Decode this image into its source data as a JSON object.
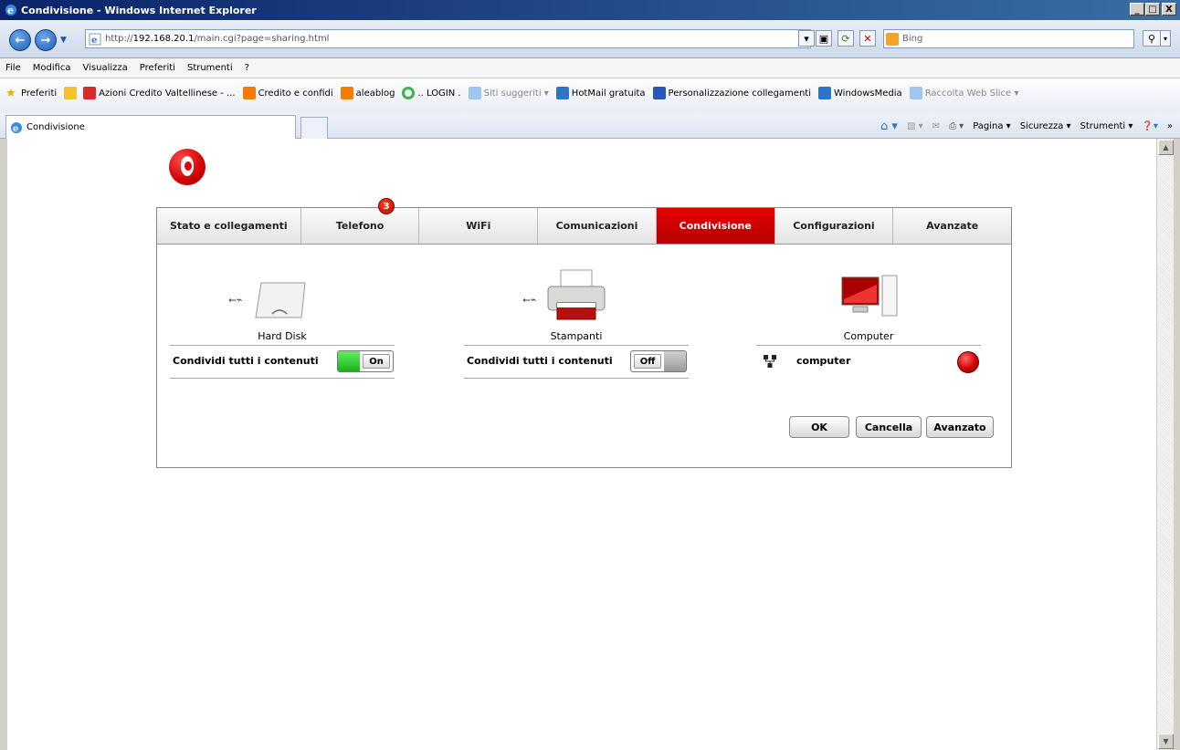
{
  "window": {
    "title": "Condivisione - Windows Internet Explorer",
    "controls": [
      "_",
      "□",
      "X"
    ]
  },
  "address": {
    "url_prefix": "http://",
    "url_host": "192.168.20.1",
    "url_path": "/main.cgi?page=sharing.html",
    "search_placeholder": "Bing"
  },
  "menu": [
    "File",
    "Modifica",
    "Visualizza",
    "Preferiti",
    "Strumenti",
    "?"
  ],
  "favorites": {
    "label": "Preferiti",
    "items": [
      {
        "label": "Azioni Credito Valtellinese - ...",
        "color": "#d82c2c",
        "dim": false
      },
      {
        "label": "Credito e confidi",
        "color": "#f57c00",
        "dim": false
      },
      {
        "label": "aleablog",
        "color": "#f57c00",
        "dim": false
      },
      {
        "label": ".. LOGIN .",
        "color": "#3bb54a",
        "dim": false
      },
      {
        "label": "Siti suggeriti ▾",
        "color": "#2c76c9",
        "dim": true
      },
      {
        "label": "HotMail gratuita",
        "color": "#2c76c9",
        "dim": false
      },
      {
        "label": "Personalizzazione collegamenti",
        "color": "#2a57b8",
        "dim": false
      },
      {
        "label": "WindowsMedia",
        "color": "#2c76c9",
        "dim": false
      },
      {
        "label": "Raccolta Web Slice ▾",
        "color": "#2c76c9",
        "dim": true
      }
    ]
  },
  "tabbar": {
    "tab_title": "Condivisione",
    "commands": [
      "Pagina ▾",
      "Sicurezza ▾",
      "Strumenti ▾"
    ]
  },
  "router": {
    "tabs": [
      "Stato e collegamenti",
      "Telefono",
      "WiFi",
      "Comunicazioni",
      "Condivisione",
      "Configurazioni",
      "Avanzate"
    ],
    "active_tab": "Condivisione",
    "badge": "3",
    "devices": {
      "hard_disk": {
        "label": "Hard Disk",
        "share_label": "Condividi tutti i contenuti",
        "toggle": "On"
      },
      "printers": {
        "label": "Stampanti",
        "share_label": "Condividi tutti i contenuti",
        "toggle": "Off"
      },
      "computer": {
        "label": "Computer",
        "name": "computer",
        "status_color": "#d00000"
      }
    },
    "buttons": {
      "ok": "OK",
      "cancel": "Cancella",
      "advanced": "Avanzato"
    }
  }
}
